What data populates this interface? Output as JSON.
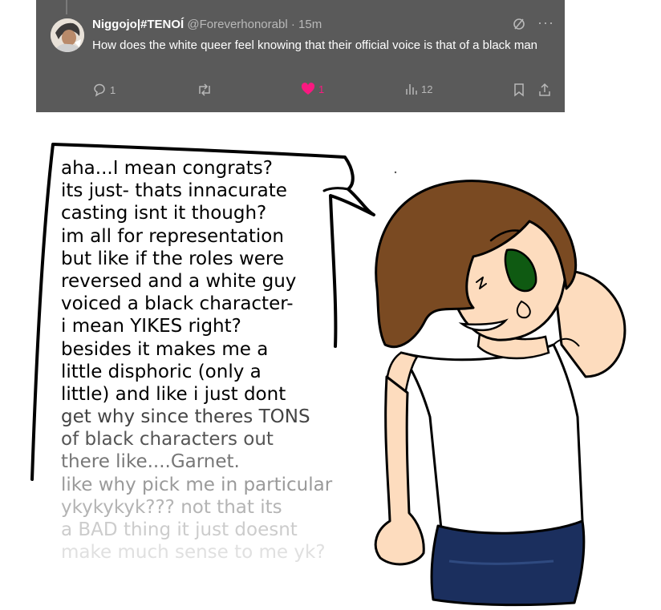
{
  "tweet": {
    "display_name": "Niggojo|#TENOÍ",
    "handle": "@Foreverhonorabl",
    "separator": "·",
    "time": "15m",
    "text": "How does the white queer feel knowing that their official voice is that of a black man",
    "actions": {
      "replies": "1",
      "likes": "1",
      "views": "12"
    },
    "icons": [
      "grok-icon",
      "more-icon",
      "reply-icon",
      "retweet-icon",
      "heart-icon",
      "views-icon",
      "bookmark-icon",
      "share-icon"
    ],
    "colors": {
      "background": "#5a5a5a",
      "like": "#f91880",
      "muted": "#b8b8b8"
    }
  },
  "comic": {
    "speech_lines": [
      {
        "text": "aha...I mean congrats?",
        "color": "#000000"
      },
      {
        "text": "its just- thats innacurate",
        "color": "#000000"
      },
      {
        "text": "casting isnt it though?",
        "color": "#000000"
      },
      {
        "text": "im all for representation",
        "color": "#000000"
      },
      {
        "text": "but like if the roles were",
        "color": "#000000"
      },
      {
        "text": "reversed and a white guy",
        "color": "#000000"
      },
      {
        "text": "voiced a black character-",
        "color": "#000000"
      },
      {
        "text": "i mean YIKES right?",
        "color": "#000000"
      },
      {
        "text": "besides it makes me a",
        "color": "#000000"
      },
      {
        "text": "little disphoric (only a",
        "color": "#000000"
      },
      {
        "text": "little) and like i just dont",
        "color": "#000000"
      },
      {
        "text": "get why since theres TONS",
        "color": "#444444"
      },
      {
        "text": "of black characters out",
        "color": "#555555"
      },
      {
        "text": "there like....Garnet.",
        "color": "#777777"
      },
      {
        "text": "like why pick me in particular",
        "color": "#9a9a9a"
      },
      {
        "text": "ykykykyk??? not that its",
        "color": "#b4b4b4"
      },
      {
        "text": "a BAD thing it just doesnt",
        "color": "#cccccc"
      },
      {
        "text": "make much sense to me yk?",
        "color": "#e0e0e0"
      }
    ],
    "colors": {
      "skin": "#fddcbe",
      "hair": "#7a4a22",
      "eye": "#0f5a12",
      "jeans": "#1b2f5e",
      "shirt": "#ffffff"
    }
  }
}
